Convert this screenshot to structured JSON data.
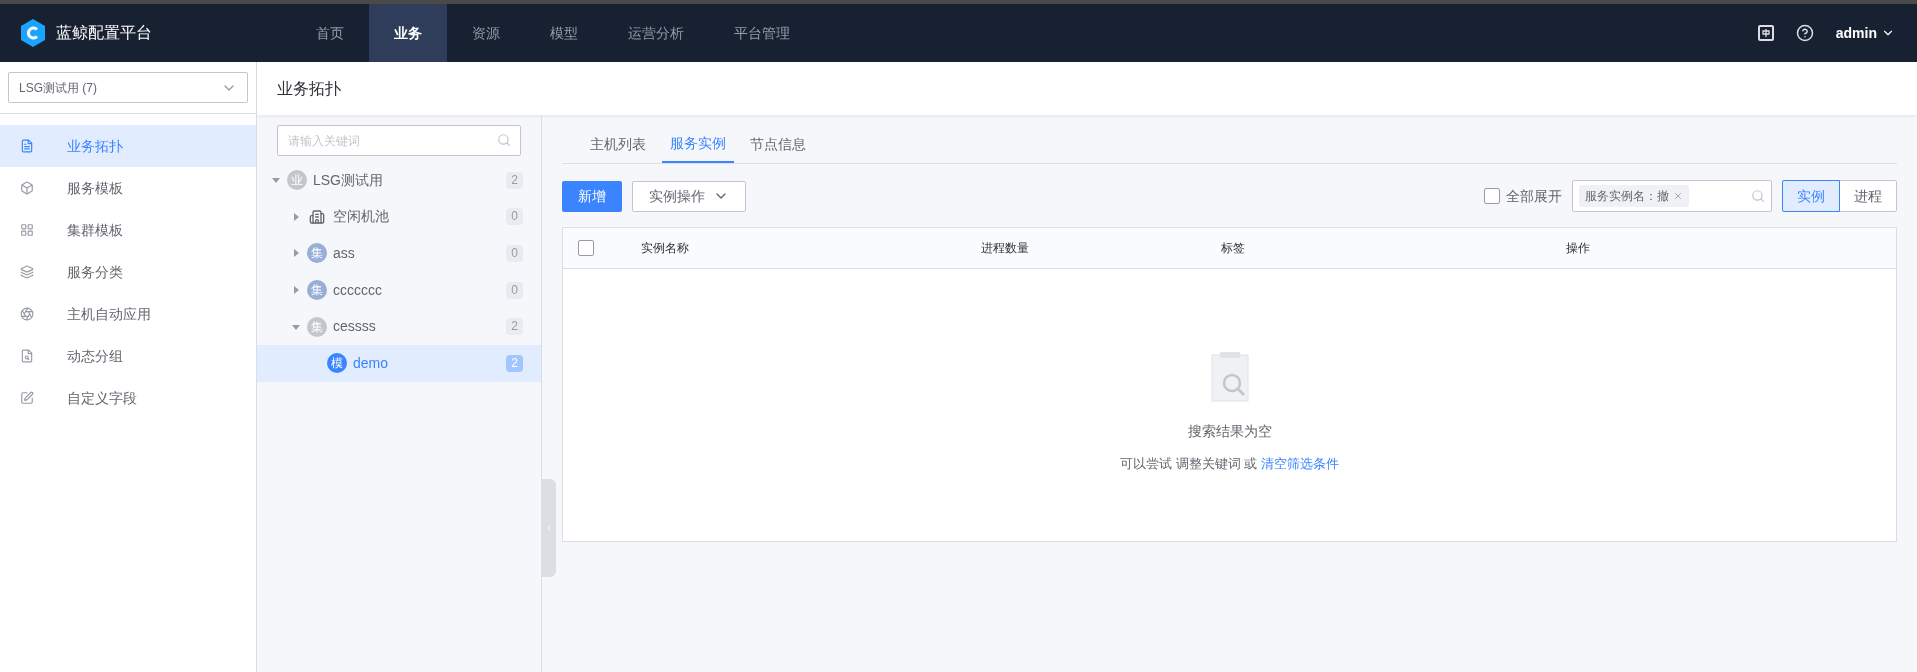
{
  "brand": {
    "title": "蓝鲸配置平台"
  },
  "nav": [
    {
      "label": "首页",
      "selected": false
    },
    {
      "label": "业务",
      "selected": true
    },
    {
      "label": "资源",
      "selected": false
    },
    {
      "label": "模型",
      "selected": false
    },
    {
      "label": "运营分析",
      "selected": false
    },
    {
      "label": "平台管理",
      "selected": false
    }
  ],
  "user": {
    "name": "admin"
  },
  "business_select": {
    "value": "LSG测试用 (7)"
  },
  "sidebar": {
    "items": [
      {
        "label": "业务拓扑",
        "selected": true
      },
      {
        "label": "服务模板",
        "selected": false
      },
      {
        "label": "集群模板",
        "selected": false
      },
      {
        "label": "服务分类",
        "selected": false
      },
      {
        "label": "主机自动应用",
        "selected": false
      },
      {
        "label": "动态分组",
        "selected": false
      },
      {
        "label": "自定义字段",
        "selected": false
      }
    ]
  },
  "page_title": "业务拓扑",
  "tree": {
    "search": {
      "placeholder": "请输入关键词"
    },
    "nodes": [
      {
        "kind": "letter",
        "badge": "业",
        "color": "#c4c6cc",
        "label": "LSG测试用",
        "count": "2",
        "expanded": true,
        "selected": false,
        "children": [
          {
            "kind": "pool",
            "label": "空闲机池",
            "count": "0",
            "expanded": false,
            "selected": false
          },
          {
            "kind": "letter",
            "badge": "集",
            "color": "#97aed6",
            "label": "ass",
            "count": "0",
            "expanded": false,
            "selected": false
          },
          {
            "kind": "letter",
            "badge": "集",
            "color": "#97aed6",
            "label": "ccccccc",
            "count": "0",
            "expanded": false,
            "selected": false
          },
          {
            "kind": "letter",
            "badge": "集",
            "color": "#c4c6cc",
            "label": "cessss",
            "count": "2",
            "expanded": true,
            "selected": false,
            "children": [
              {
                "kind": "letter",
                "badge": "模",
                "color": "#3a84ff",
                "label": "demo",
                "count": "2",
                "selected": true
              }
            ]
          }
        ]
      }
    ]
  },
  "tabs": [
    {
      "label": "主机列表",
      "selected": false
    },
    {
      "label": "服务实例",
      "selected": true
    },
    {
      "label": "节点信息",
      "selected": false
    }
  ],
  "toolbar": {
    "add_button": "新增",
    "actions_button": "实例操作",
    "expand_all": {
      "label": "全部展开",
      "checked": false
    },
    "filter_tag": "服务实例名：撤",
    "view_toggle": [
      {
        "label": "实例",
        "selected": true
      },
      {
        "label": "进程",
        "selected": false
      }
    ]
  },
  "table": {
    "select_all": {
      "checked": false
    },
    "columns": [
      "实例名称",
      "进程数量",
      "标签",
      "操作"
    ]
  },
  "empty_state": {
    "title": "搜索结果为空",
    "hint": "可以尝试 调整关键词 或 ",
    "link": "清空筛选条件"
  }
}
